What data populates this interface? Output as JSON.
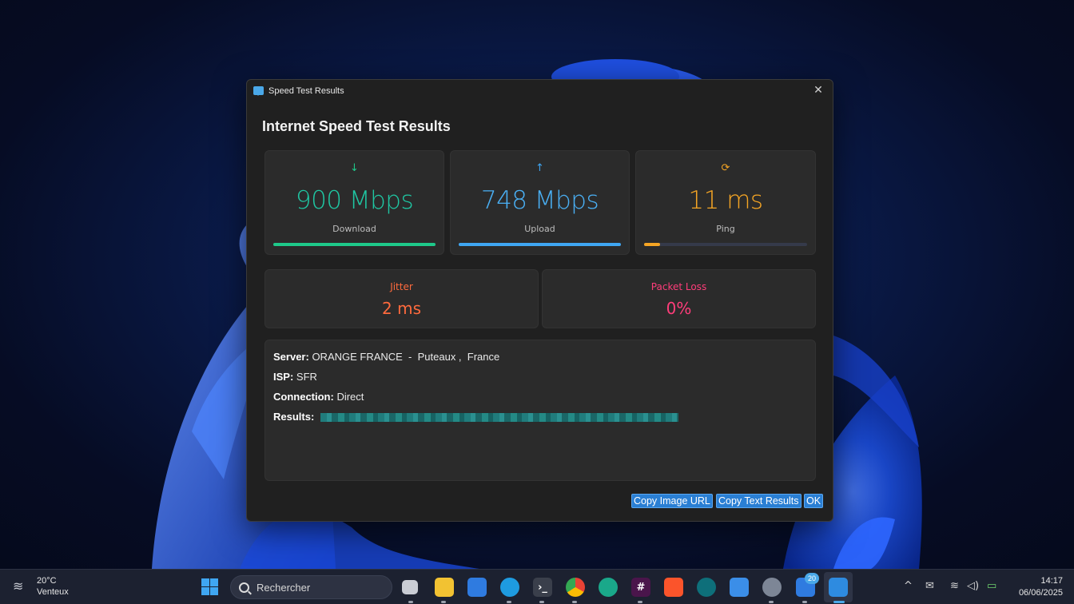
{
  "window": {
    "title": "Speed Test Results"
  },
  "dialog": {
    "heading": "Internet Speed Test Results",
    "download": {
      "icon": "↓",
      "value": "900 Mbps",
      "label": "Download",
      "progress": 1.0,
      "color": "#1ec98a"
    },
    "upload": {
      "icon": "↑",
      "value": "748 Mbps",
      "label": "Upload",
      "progress": 1.0,
      "color": "#3fa6f2"
    },
    "ping": {
      "icon": "⟳",
      "value": "11 ms",
      "label": "Ping",
      "progress": 0.1,
      "color": "#f5a524"
    },
    "jitter": {
      "label": "Jitter",
      "value": "2 ms",
      "color": "#ff6a3d"
    },
    "packet_loss": {
      "label": "Packet Loss",
      "value": "0%",
      "color": "#ff3d7a"
    },
    "info": {
      "server_label": "Server:",
      "server_value": "ORANGE FRANCE  -  Puteaux ,  France",
      "isp_label": "ISP:",
      "isp_value": "SFR",
      "connection_label": "Connection:",
      "connection_value": "Direct",
      "results_label": "Results:"
    },
    "buttons": {
      "copy_image_url": "Copy Image URL",
      "copy_text_results": "Copy Text Results",
      "ok": "OK"
    }
  },
  "taskbar": {
    "weather": {
      "temperature": "20°C",
      "condition": "Venteux"
    },
    "search_placeholder": "Rechercher",
    "notification_badge": "20",
    "clock": {
      "time": "14:17",
      "date": "06/06/2025"
    }
  }
}
